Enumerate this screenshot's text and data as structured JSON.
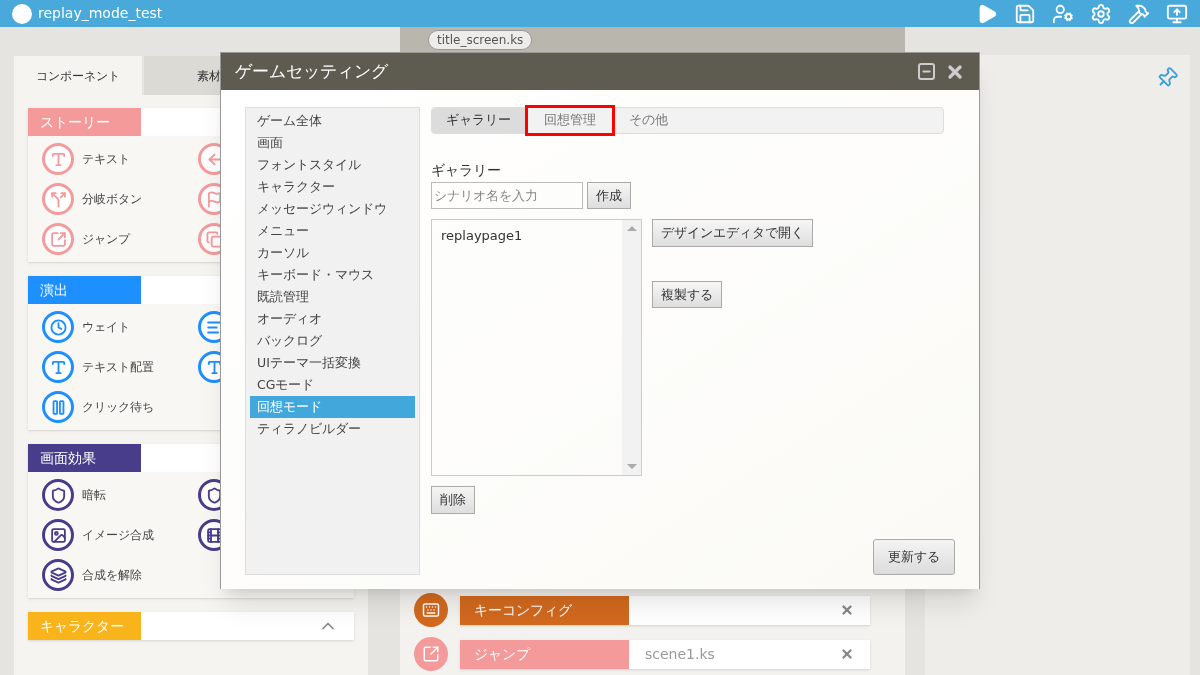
{
  "app_bar": {
    "title": "replay_mode_test"
  },
  "left_panel": {
    "tabs": [
      {
        "label": "コンポーネント",
        "selected": true
      },
      {
        "label": "素材",
        "selected": false
      }
    ],
    "sections": [
      {
        "title": "ストーリー",
        "color": "#f59a9a",
        "items": [
          {
            "label": "テキスト",
            "kind": "text"
          },
          {
            "label": "分岐ボタン",
            "kind": "branch"
          },
          {
            "label": "ジャンプ",
            "kind": "jump"
          }
        ]
      },
      {
        "title": "演出",
        "color": "#1e8fff",
        "items": [
          {
            "label": "ウェイト",
            "kind": "clock"
          },
          {
            "label": "テキスト配置",
            "kind": "text"
          },
          {
            "label": "クリック待ち",
            "kind": "pause"
          }
        ]
      },
      {
        "title": "画面効果",
        "color": "#483d8b",
        "items": [
          {
            "label": "暗転",
            "kind": "shield"
          },
          {
            "label": "イメージ合成",
            "kind": "image"
          },
          {
            "label": "合成を解除",
            "kind": "layers"
          }
        ]
      },
      {
        "title": "キャラクター",
        "color": "#f8b41a"
      }
    ]
  },
  "editor": {
    "file_tab": "title_screen.ks",
    "rows": [
      {
        "label": "キーコンフィグ",
        "color": "#d2691e",
        "kind": "keyboard"
      },
      {
        "label": "ジャンプ",
        "color": "#f59a9a",
        "kind": "jump",
        "value": "scene1.ks"
      }
    ]
  },
  "dialog": {
    "title": "ゲームセッティング",
    "nav": [
      {
        "label": "ゲーム全体",
        "selected": false
      },
      {
        "label": "画面",
        "selected": false
      },
      {
        "label": "フォントスタイル",
        "selected": false
      },
      {
        "label": "キャラクター",
        "selected": false
      },
      {
        "label": "メッセージウィンドウ",
        "selected": false
      },
      {
        "label": "メニュー",
        "selected": false
      },
      {
        "label": "カーソル",
        "selected": false
      },
      {
        "label": "キーボード・マウス",
        "selected": false
      },
      {
        "label": "既読管理",
        "selected": false
      },
      {
        "label": "オーディオ",
        "selected": false
      },
      {
        "label": "バックログ",
        "selected": false
      },
      {
        "label": "UIテーマ一括変換",
        "selected": false
      },
      {
        "label": "CGモード",
        "selected": false
      },
      {
        "label": "回想モード",
        "selected": true
      },
      {
        "label": "ティラノビルダー",
        "selected": false
      }
    ],
    "tabs": [
      {
        "label": "ギャラリー",
        "selected": true,
        "highlighted": false
      },
      {
        "label": "回想管理",
        "selected": false,
        "highlighted": true
      },
      {
        "label": "その他",
        "selected": false,
        "highlighted": false
      }
    ],
    "gallery_label": "ギャラリー",
    "name_input": {
      "placeholder": "シナリオ名を入力"
    },
    "create_button": "作成",
    "list": [
      "replaypage1"
    ],
    "open_button": "デザインエディタで開く",
    "duplicate_button": "複製する",
    "delete_button": "削除",
    "update_button": "更新する"
  }
}
